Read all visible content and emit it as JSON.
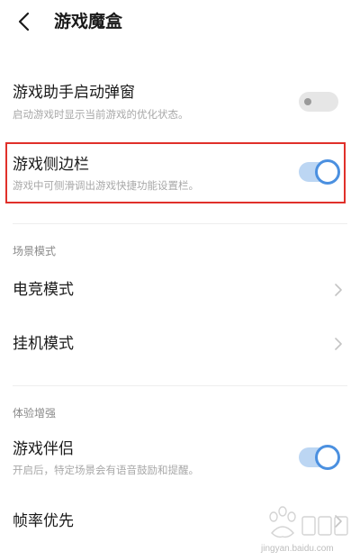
{
  "header": {
    "title": "游戏魔盒"
  },
  "settings": {
    "assistant_popup": {
      "title": "游戏助手启动弹窗",
      "subtitle": "启动游戏时显示当前游戏的优化状态。",
      "toggle_state": "off"
    },
    "game_sidebar": {
      "title": "游戏侧边栏",
      "subtitle": "游戏中可侧滑调出游戏快捷功能设置栏。",
      "toggle_state": "on"
    }
  },
  "scene_section": {
    "label": "场景模式",
    "items": [
      {
        "title": "电竞模式"
      },
      {
        "title": "挂机模式"
      }
    ]
  },
  "experience_section": {
    "label": "体验增强",
    "game_companion": {
      "title": "游戏伴侣",
      "subtitle": "开启后，特定场景会有语音鼓励和提醒。",
      "toggle_state": "on"
    },
    "frame_priority": {
      "title": "帧率优先"
    }
  },
  "watermark": {
    "subtext": "jingyan.baidu.com"
  },
  "colors": {
    "accent": "#4b90e0",
    "highlight_border": "#e0302a",
    "toggle_on_track": "#bcd6f3",
    "toggle_off_track": "#e6e6e6"
  }
}
